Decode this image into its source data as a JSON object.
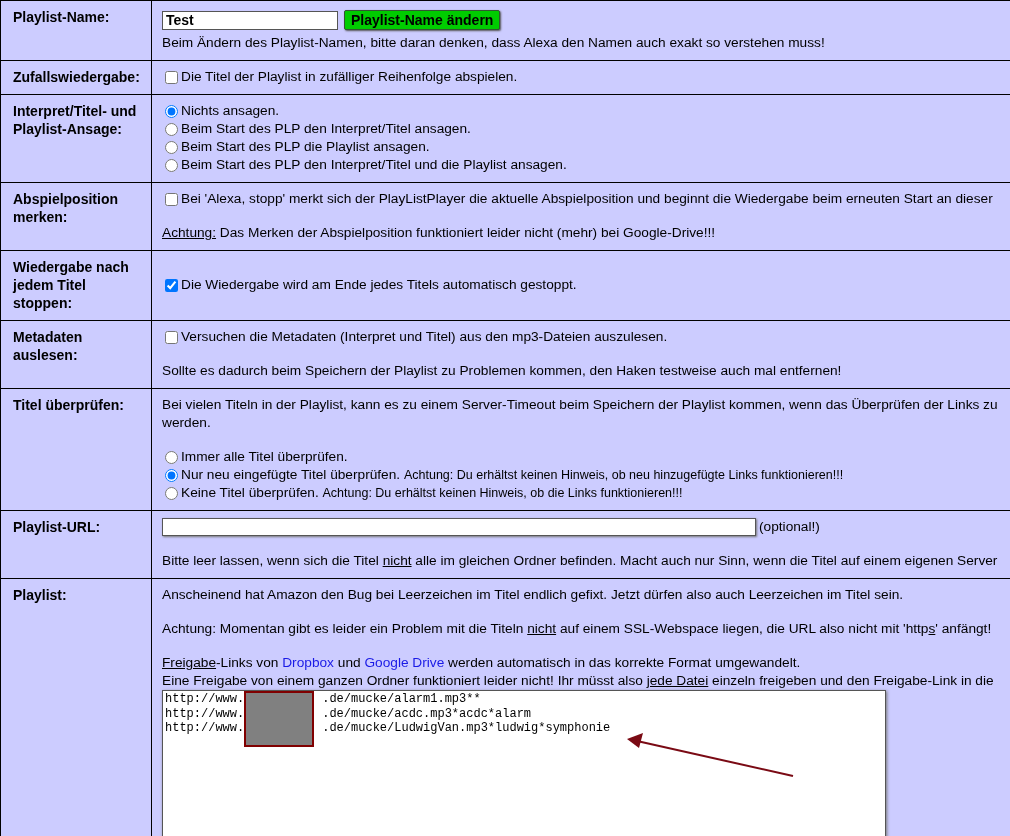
{
  "rows": [
    {
      "label": "Playlist-Name:",
      "blocks": [
        {
          "kind": "name-field",
          "value": "Test",
          "button": "Playlist-Name ändern",
          "note": "Beim Ändern des Playlist-Namen, bitte daran denken, dass Alexa den Namen auch exakt so verstehen muss!"
        }
      ]
    },
    {
      "label": "Zufallswiedergabe:",
      "blocks": [
        {
          "kind": "checkbox",
          "label": "Die Titel der Playlist in zufälliger Reihenfolge abspielen.",
          "checked": false
        }
      ]
    },
    {
      "label": "Interpret/Titel- und Playlist-Ansage:",
      "blocks": [
        {
          "kind": "radios",
          "options": [
            {
              "segments": [
                {
                  "text": "Nichts ansagen.",
                  "kind": "text"
                }
              ],
              "selected": true
            },
            {
              "segments": [
                {
                  "text": "Beim Start des PLP den Interpret/Titel ansagen.",
                  "kind": "text"
                }
              ],
              "selected": false
            },
            {
              "segments": [
                {
                  "text": "Beim Start des PLP die Playlist ansagen.",
                  "kind": "text"
                }
              ],
              "selected": false
            },
            {
              "segments": [
                {
                  "text": "Beim Start des PLP den Interpret/Titel und die Playlist ansagen.",
                  "kind": "text"
                }
              ],
              "selected": false
            }
          ]
        }
      ]
    },
    {
      "label": "Abspielposition merken:",
      "blocks": [
        {
          "kind": "checkbox",
          "label": "Bei 'Alexa, stopp' merkt sich der PlayListPlayer die aktuelle Abspielposition und beginnt die Wiedergabe beim erneuten Start an dieser",
          "checked": false
        },
        {
          "kind": "paragraph",
          "lines": [
            [
              {
                "text": "Achtung:",
                "kind": "underline"
              },
              {
                "text": " Das Merken der Abspielposition funktioniert leider nicht (mehr) bei Google-Drive!!!",
                "kind": "text"
              }
            ]
          ]
        }
      ]
    },
    {
      "label": "Wiedergabe nach jedem Titel stoppen:",
      "blocks": [
        {
          "kind": "checkbox",
          "label": "Die Wiedergabe wird am Ende jedes Titels automatisch gestoppt.",
          "checked": true
        }
      ]
    },
    {
      "label": "Metadaten auslesen:",
      "blocks": [
        {
          "kind": "checkbox",
          "label": "Versuchen die Metadaten (Interpret und Titel) aus den mp3-Dateien auszulesen.",
          "checked": false
        },
        {
          "kind": "paragraph",
          "lines": [
            [
              {
                "text": "Sollte es dadurch beim Speichern der Playlist zu Problemen kommen, den Haken testweise auch mal entfernen!",
                "kind": "text"
              }
            ]
          ]
        }
      ]
    },
    {
      "label": "Titel überprüfen:",
      "blocks": [
        {
          "kind": "paragraph",
          "lines": [
            [
              {
                "text": "Bei vielen Titeln in der Playlist, kann es zu einem Server-Timeout beim Speichern der Playlist kommen, wenn das Überprüfen der Links zu",
                "kind": "text"
              }
            ],
            [
              {
                "text": "werden.",
                "kind": "text"
              }
            ]
          ]
        },
        {
          "kind": "radios",
          "options": [
            {
              "segments": [
                {
                  "text": "Immer alle Titel überprüfen.",
                  "kind": "text"
                }
              ],
              "selected": false
            },
            {
              "segments": [
                {
                  "text": "Nur neu eingefügte Titel überprüfen. ",
                  "kind": "text"
                },
                {
                  "text": "Achtung: Du erhältst keinen Hinweis, ob neu hinzugefügte Links funktionieren!!!",
                  "kind": "small"
                }
              ],
              "selected": true
            },
            {
              "segments": [
                {
                  "text": "Keine Titel überprüfen. ",
                  "kind": "text"
                },
                {
                  "text": "Achtung: Du erhältst keinen Hinweis, ob die Links funktionieren!!!",
                  "kind": "small"
                }
              ],
              "selected": false
            }
          ]
        }
      ]
    },
    {
      "label": "Playlist-URL:",
      "blocks": [
        {
          "kind": "url-field",
          "hint": "(optional!)"
        },
        {
          "kind": "paragraph",
          "lines": [
            [
              {
                "text": "Bitte leer lassen, wenn sich die Titel ",
                "kind": "text"
              },
              {
                "text": "nicht",
                "kind": "underline"
              },
              {
                "text": " alle im gleichen Ordner befinden. Macht auch nur Sinn, wenn die Titel auf einem eigenen Server",
                "kind": "text"
              }
            ]
          ]
        }
      ]
    },
    {
      "label": "Playlist:",
      "blocks": [
        {
          "kind": "paragraph",
          "lines": [
            [
              {
                "text": "Anscheinend hat Amazon den Bug bei Leerzeichen im Titel endlich gefixt. Jetzt dürfen also auch Leerzeichen im Titel sein.",
                "kind": "text"
              }
            ]
          ]
        },
        {
          "kind": "paragraph",
          "lines": [
            [
              {
                "text": "Achtung: Momentan gibt es leider ein Problem mit die Titeln ",
                "kind": "text"
              },
              {
                "text": "nicht",
                "kind": "underline"
              },
              {
                "text": " auf einem SSL-Webspace liegen, die URL also nicht mit 'http",
                "kind": "text"
              },
              {
                "text": "s",
                "kind": "underline"
              },
              {
                "text": "' anfängt!",
                "kind": "text"
              }
            ]
          ]
        },
        {
          "kind": "paragraph",
          "lines": [
            [
              {
                "text": "Freigabe",
                "kind": "underline"
              },
              {
                "text": "-Links von ",
                "kind": "text"
              },
              {
                "text": "Dropbox",
                "kind": "link"
              },
              {
                "text": " und ",
                "kind": "text"
              },
              {
                "text": "Google Drive",
                "kind": "link"
              },
              {
                "text": " werden automatisch in das korrekte Format umgewandelt.",
                "kind": "text"
              }
            ],
            [
              {
                "text": "Eine Freigabe von einem ganzen Ordner funktioniert leider nicht! Ihr müsst also ",
                "kind": "text"
              },
              {
                "text": "jede Datei",
                "kind": "underline"
              },
              {
                "text": " einzeln freigeben und den Freigabe-Link in die",
                "kind": "text"
              }
            ]
          ]
        },
        {
          "kind": "textarea",
          "lines": [
            {
              "prefix": "http://www.",
              "suffix": ".de/mucke/alarm1.mp3**"
            },
            {
              "prefix": "http://www.",
              "suffix": ".de/mucke/acdc.mp3*acdc*alarm"
            },
            {
              "prefix": "http://www.",
              "suffix": ".de/mucke/LudwigVan.mp3*ludwig*symphonie"
            }
          ]
        }
      ]
    }
  ]
}
